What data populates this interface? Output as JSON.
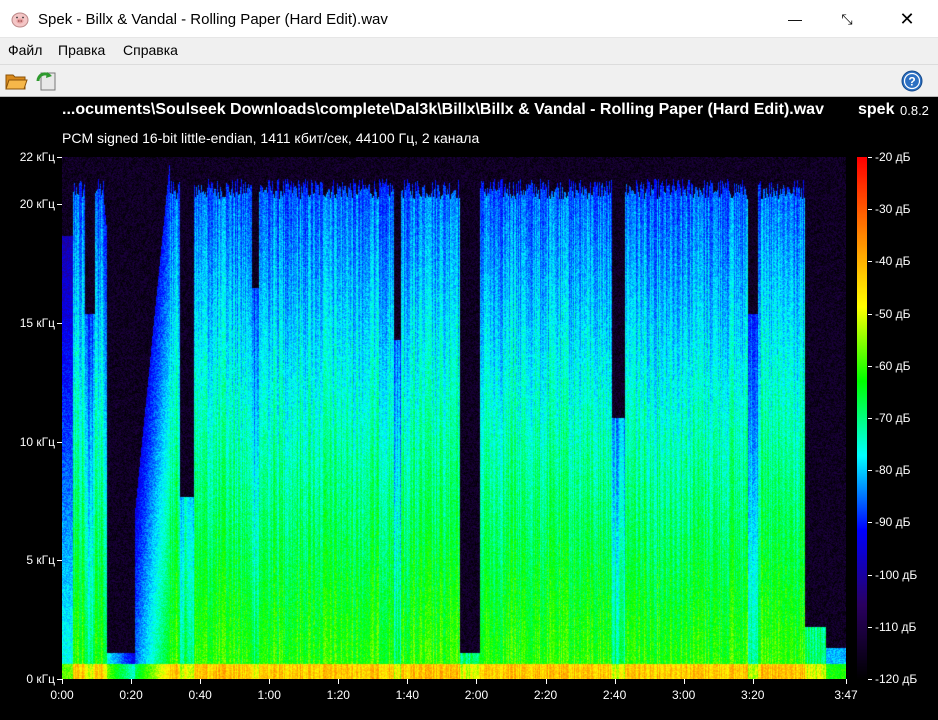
{
  "window": {
    "title": "Spek - Billx & Vandal - Rolling Paper (Hard Edit).wav",
    "minimize_glyph": "—",
    "maximize_glyph": "⤡",
    "close_glyph": "✕"
  },
  "menu": {
    "items": [
      "Файл",
      "Правка",
      "Справка"
    ]
  },
  "toolbar": {
    "icons": [
      "folder-open-icon",
      "reload-icon",
      "help-icon"
    ]
  },
  "header": {
    "file_path": "...ocuments\\Soulseek Downloads\\complete\\Dal3k\\Billx\\Billx & Vandal - Rolling Paper (Hard Edit).wav",
    "app_name": "spek",
    "version": "0.8.2",
    "stream_info": "PCM signed 16-bit little-endian, 1411 кбит/сек, 44100 Гц, 2 канала"
  },
  "chart_data": {
    "type": "heatmap",
    "x_ticks": [
      "0:00",
      "0:20",
      "0:40",
      "1:00",
      "1:20",
      "1:40",
      "2:00",
      "2:20",
      "2:40",
      "3:00",
      "3:20",
      "3:47"
    ],
    "x_tick_seconds": [
      0,
      20,
      40,
      60,
      80,
      100,
      120,
      140,
      160,
      180,
      200,
      227
    ],
    "x_max_seconds": 227,
    "y_ticks": [
      "0 кГц",
      "5 кГц",
      "10 кГц",
      "15 кГц",
      "20 кГц",
      "22 кГц"
    ],
    "y_tick_khz": [
      0,
      5,
      10,
      15,
      20,
      22
    ],
    "y_max_khz": 22,
    "colorbar_labels": [
      "-20 дБ",
      "-30 дБ",
      "-40 дБ",
      "-50 дБ",
      "-60 дБ",
      "-70 дБ",
      "-80 дБ",
      "-90 дБ",
      "-100 дБ",
      "-110 дБ",
      "-120 дБ"
    ],
    "colorbar_db": [
      -20,
      -30,
      -40,
      -50,
      -60,
      -70,
      -80,
      -90,
      -100,
      -110,
      -120
    ],
    "colorbar_colors": [
      "#ff0000",
      "#ff8000",
      "#ffff00",
      "#00ff00",
      "#00ffff",
      "#0000ff",
      "#2a0060",
      "#000000"
    ]
  }
}
